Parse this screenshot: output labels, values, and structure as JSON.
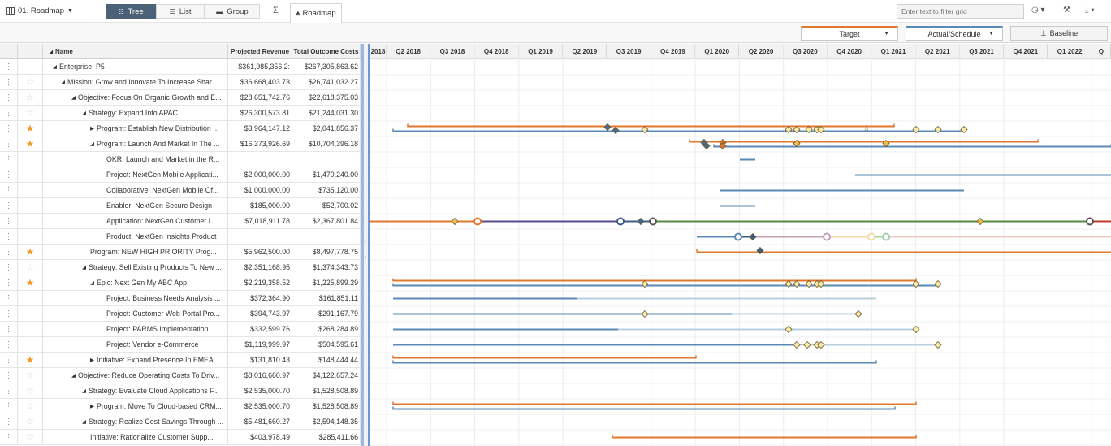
{
  "toolbar": {
    "title": "01. Roadmap",
    "views": [
      {
        "label": "Tree",
        "icon": "tree-icon",
        "active": true
      },
      {
        "label": "List",
        "icon": "list-icon",
        "active": false
      },
      {
        "label": "Group",
        "icon": "folder-icon",
        "active": false
      }
    ],
    "sigma": "Σ",
    "roadmap_tab": "Roadmap",
    "filter_placeholder": "Enter text to filter grid"
  },
  "legend": {
    "target_label": "Target",
    "actual_label": "Actual/Schedule",
    "baseline_label": "Baseline",
    "target_color": "#e0772f",
    "actual_color": "#5a8ab5"
  },
  "columns": {
    "name": "Name",
    "revenue": "Projected Revenue",
    "costs": "Total Outcome Costs"
  },
  "quarters": [
    "2018",
    "Q2 2018",
    "Q3 2018",
    "Q4 2018",
    "Q1 2019",
    "Q2 2019",
    "Q3 2019",
    "Q4 2019",
    "Q1 2020",
    "Q2 2020",
    "Q3 2020",
    "Q4 2020",
    "Q1 2021",
    "Q2 2021",
    "Q3 2021",
    "Q4 2021",
    "Q1 2022",
    "Q"
  ],
  "rows": [
    {
      "name": "Enterprise: P5",
      "indent": 0,
      "toggle": "down",
      "star": "none",
      "revenue": "$361,985,356.2:",
      "cost": "$267,305,863.62"
    },
    {
      "name": "Mission: Grow and Innovate To Increase Shar...",
      "indent": 1,
      "toggle": "down",
      "star": "off",
      "revenue": "$36,668,403.73",
      "cost": "$26,741,032.27"
    },
    {
      "name": "Objective: Focus On Organic Growth and E...",
      "indent": 2,
      "toggle": "down",
      "star": "off",
      "revenue": "$28,651,742.76",
      "cost": "$22,618,375.03"
    },
    {
      "name": "Strategy: Expand Into APAC",
      "indent": 3,
      "toggle": "down",
      "star": "off",
      "revenue": "$26,300,573.81",
      "cost": "$21,244,031.30"
    },
    {
      "name": "Program: Establish New Distribution ...",
      "indent": 4,
      "toggle": "right",
      "star": "on",
      "revenue": "$3,964,147.12",
      "cost": "$2,041,856.37"
    },
    {
      "name": "Program: Launch And Market In The ...",
      "indent": 4,
      "toggle": "down",
      "star": "on",
      "revenue": "$16,373,926.69",
      "cost": "$10,704,396.18"
    },
    {
      "name": "OKR: Launch and Market in the R...",
      "indent": 5,
      "toggle": "none",
      "star": "none",
      "revenue": "",
      "cost": ""
    },
    {
      "name": "Project: NextGen Mobile Applicati...",
      "indent": 5,
      "toggle": "none",
      "star": "none",
      "revenue": "$2,000,000.00",
      "cost": "$1,470,240.00"
    },
    {
      "name": "Collaborative: NextGen Mobile Of...",
      "indent": 5,
      "toggle": "none",
      "star": "none",
      "revenue": "$1,000,000.00",
      "cost": "$735,120.00"
    },
    {
      "name": "Enabler: NextGen Secure Design",
      "indent": 5,
      "toggle": "none",
      "star": "none",
      "revenue": "$185,000.00",
      "cost": "$52,700.02"
    },
    {
      "name": "Application: NextGen Customer I...",
      "indent": 5,
      "toggle": "none",
      "star": "none",
      "revenue": "$7,018,911.78",
      "cost": "$2,367,801.84"
    },
    {
      "name": "Product: NextGen Insights Product",
      "indent": 5,
      "toggle": "none",
      "star": "none",
      "revenue": "",
      "cost": ""
    },
    {
      "name": "Program: NEW HIGH PRIORITY Prog...",
      "indent": 4,
      "toggle": "none",
      "star": "on",
      "revenue": "$5,962,500.00",
      "cost": "$8,497,778.75"
    },
    {
      "name": "Strategy: Sell Existing Products To New ...",
      "indent": 3,
      "toggle": "down",
      "star": "off",
      "revenue": "$2,351,168.95",
      "cost": "$1,374,343.73"
    },
    {
      "name": "Epic: Next Gen My ABC App",
      "indent": 4,
      "toggle": "down",
      "star": "on",
      "revenue": "$2,219,358.52",
      "cost": "$1,225,899.29"
    },
    {
      "name": "Project: Business Needs Analysis ...",
      "indent": 5,
      "toggle": "none",
      "star": "none",
      "revenue": "$372,364.90",
      "cost": "$161,851.11"
    },
    {
      "name": "Project: Customer Web Portal Pro...",
      "indent": 5,
      "toggle": "none",
      "star": "none",
      "revenue": "$394,743.97",
      "cost": "$291,167.79"
    },
    {
      "name": "Project: PARMS Implementation",
      "indent": 5,
      "toggle": "none",
      "star": "none",
      "revenue": "$332,599.76",
      "cost": "$268,284.89"
    },
    {
      "name": "Project: Vendor e-Commerce",
      "indent": 5,
      "toggle": "none",
      "star": "none",
      "revenue": "$1,119,999.97",
      "cost": "$504,595.61"
    },
    {
      "name": "Initiative: Expand Presence In EMEA",
      "indent": 4,
      "toggle": "right",
      "star": "on",
      "revenue": "$131,810.43",
      "cost": "$148,444.44"
    },
    {
      "name": "Objective: Reduce Operating Costs To Driv...",
      "indent": 2,
      "toggle": "down",
      "star": "off",
      "revenue": "$8,016,660.97",
      "cost": "$4,122,657.24"
    },
    {
      "name": "Strategy: Evaluate Cloud Applications F...",
      "indent": 3,
      "toggle": "down",
      "star": "off",
      "revenue": "$2,535,000.70",
      "cost": "$1,528,508.89"
    },
    {
      "name": "Program: Move To Cloud-based CRM...",
      "indent": 4,
      "toggle": "right",
      "star": "off",
      "revenue": "$2,535,000.70",
      "cost": "$1,528,508.89"
    },
    {
      "name": "Strategy: Realize Cost Savings Through ...",
      "indent": 3,
      "toggle": "down",
      "star": "off",
      "revenue": "$5,481,660.27",
      "cost": "$2,594,148.35"
    },
    {
      "name": "Initiative: Rationalize Customer Supp...",
      "indent": 4,
      "toggle": "none",
      "star": "off",
      "revenue": "$403,978.49",
      "cost": "$285,411.66"
    }
  ]
}
